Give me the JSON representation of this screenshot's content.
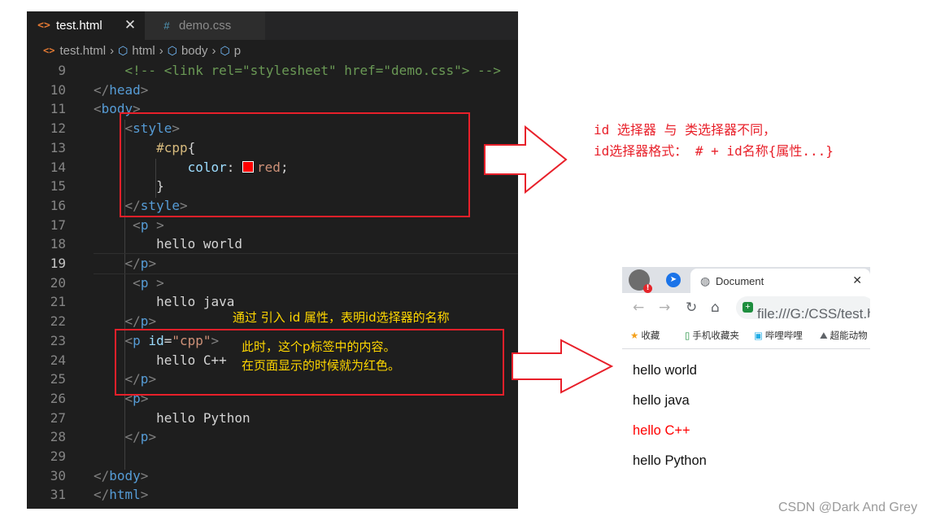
{
  "editor": {
    "tabs": [
      {
        "icon": "<>",
        "label": "test.html",
        "close": "✕",
        "active": true
      },
      {
        "icon": "#",
        "label": "demo.css",
        "active": false
      }
    ],
    "breadcrumb": [
      "test.html",
      "html",
      "body",
      "p"
    ],
    "lines": [
      {
        "num": "9",
        "text": "    <!-- <link rel=\"stylesheet\" href=\"demo.css\"> -->"
      },
      {
        "num": "10",
        "text": "</head>"
      },
      {
        "num": "11",
        "text": "<body>"
      },
      {
        "num": "12",
        "text": "    <style>"
      },
      {
        "num": "13",
        "text": "        #cpp{"
      },
      {
        "num": "14",
        "text": "            color: red;"
      },
      {
        "num": "15",
        "text": "        }"
      },
      {
        "num": "16",
        "text": "    </style>"
      },
      {
        "num": "17",
        "text": "     <p >"
      },
      {
        "num": "18",
        "text": "        hello world"
      },
      {
        "num": "19",
        "text": "    </p>"
      },
      {
        "num": "20",
        "text": "     <p >"
      },
      {
        "num": "21",
        "text": "        hello java"
      },
      {
        "num": "22",
        "text": "    </p>"
      },
      {
        "num": "23",
        "text": "    <p id=\"cpp\">"
      },
      {
        "num": "24",
        "text": "        hello C++"
      },
      {
        "num": "25",
        "text": "    </p>"
      },
      {
        "num": "26",
        "text": "    <p>"
      },
      {
        "num": "27",
        "text": "        hello Python"
      },
      {
        "num": "28",
        "text": "    </p>"
      },
      {
        "num": "29",
        "text": ""
      },
      {
        "num": "30",
        "text": "</body>"
      },
      {
        "num": "31",
        "text": "</html>"
      }
    ],
    "current_line": "19"
  },
  "annotations": {
    "right_note_line1": "id 选择器 与 类选择器不同，",
    "right_note_line2": "id选择器格式： # + id名称{属性...}",
    "yellow_top": "通过 引入 id 属性，表明id选择器的名称",
    "yellow_box_line1": "此时，这个p标签中的内容。",
    "yellow_box_line2": "在页面显示的时候就为红色。",
    "accent_red": "#e8202a",
    "accent_yellow": "#ffd700"
  },
  "browser": {
    "tab_title": "Document",
    "tab_close": "✕",
    "url": "file:///G:/CSS/test.html",
    "bookmarks": [
      "收藏",
      "手机收藏夹",
      "哔哩哔哩",
      "超能动物"
    ],
    "content": [
      {
        "text": "hello world",
        "color": "#111111"
      },
      {
        "text": "hello java",
        "color": "#111111"
      },
      {
        "text": "hello C++",
        "color": "#ff0000"
      },
      {
        "text": "hello Python",
        "color": "#111111"
      }
    ]
  },
  "watermark": "CSDN @Dark And Grey"
}
